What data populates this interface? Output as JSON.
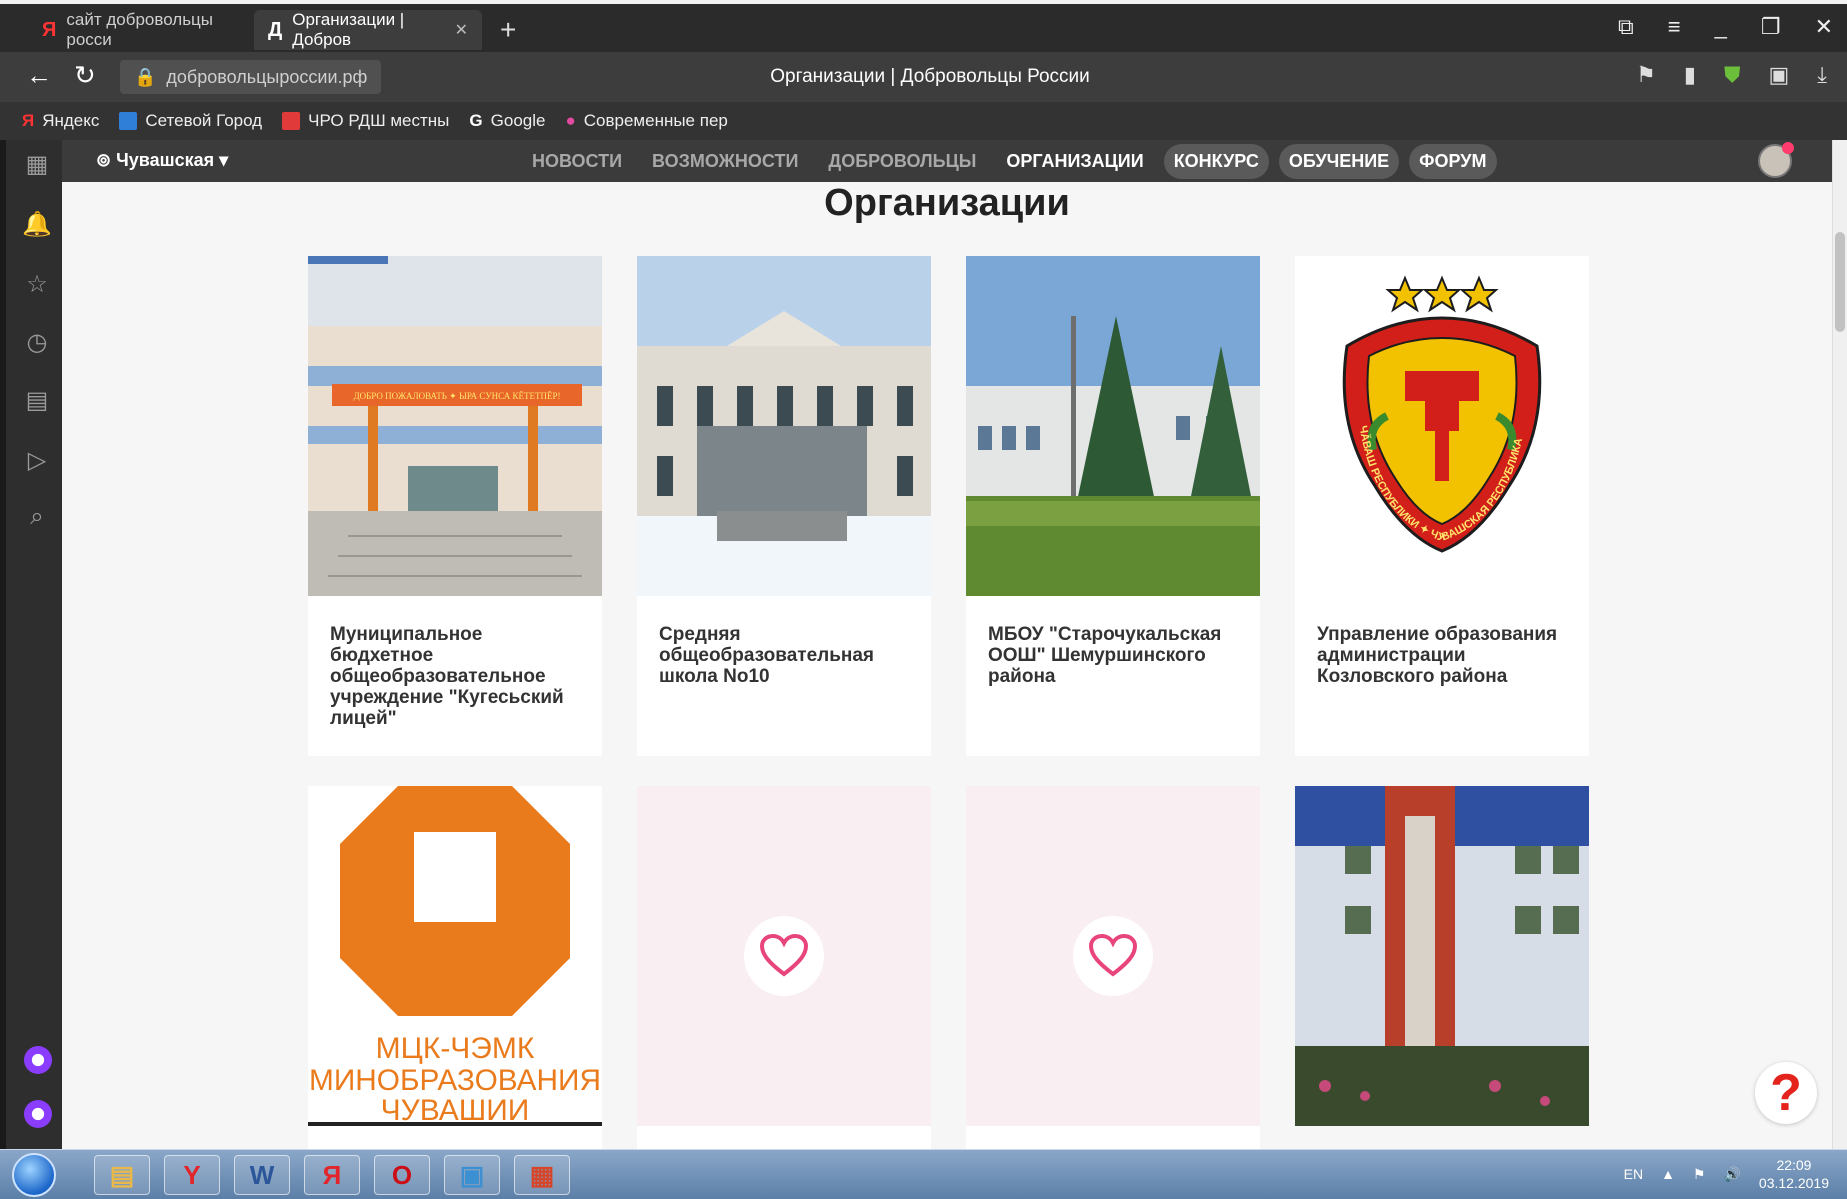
{
  "browser": {
    "tabs": [
      {
        "label": "сайт добровольцы росси",
        "icon": "Я"
      },
      {
        "label": "Организации | Добров",
        "icon": "Д"
      }
    ],
    "url": "добровольцыроссии.рф",
    "page_title": "Организации | Добровольцы России",
    "bookmarks": [
      "Яндекс",
      "Сетевой Город",
      "ЧРО РДШ местны",
      "Google",
      "Современные пер"
    ]
  },
  "site": {
    "region": "Чувашская",
    "menu": [
      "НОВОСТИ",
      "ВОЗМОЖНОСТИ",
      "ДОБРОВОЛЬЦЫ",
      "ОРГАНИЗАЦИИ",
      "КОНКУРС",
      "ОБУЧЕНИЕ",
      "ФОРУМ"
    ],
    "heading": "Организации",
    "cards": [
      {
        "title": "Муниципальное бюдхетное общеобразовательное учреждение \"Кугесьский лицей\"",
        "banner": "ДОБРО ПОЖАЛОВАТЬ ✦ ЫРА СУНСА КĔТЕТПĔР!"
      },
      {
        "title": "Средняя общеобразовательная школа No10"
      },
      {
        "title": "МБОУ \"Старочукальская ООШ\" Шемуршинского района"
      },
      {
        "title": "Управление образования администрации Козловского района",
        "emblem_text": "ЧĂВАШ РЕСПУБЛИКИ ✦ ЧУВАШСКАЯ РЕСПУБЛИКА"
      },
      {
        "title": "",
        "logo_line1": "МЦК-ЧЭМК",
        "logo_line2": "МИНОБРАЗОВАНИЯ",
        "logo_line3": "ЧУВАШИИ"
      },
      {
        "title": ""
      },
      {
        "title": ""
      },
      {
        "title": ""
      }
    ],
    "help": "?"
  },
  "taskbar": {
    "lang": "EN",
    "time": "22:09",
    "date": "03.12.2019",
    "apps": [
      "Y",
      "W",
      "Я",
      "O",
      "",
      ""
    ]
  },
  "colors": {
    "accent_pink": "#e8457c",
    "orange": "#e97b1d"
  }
}
